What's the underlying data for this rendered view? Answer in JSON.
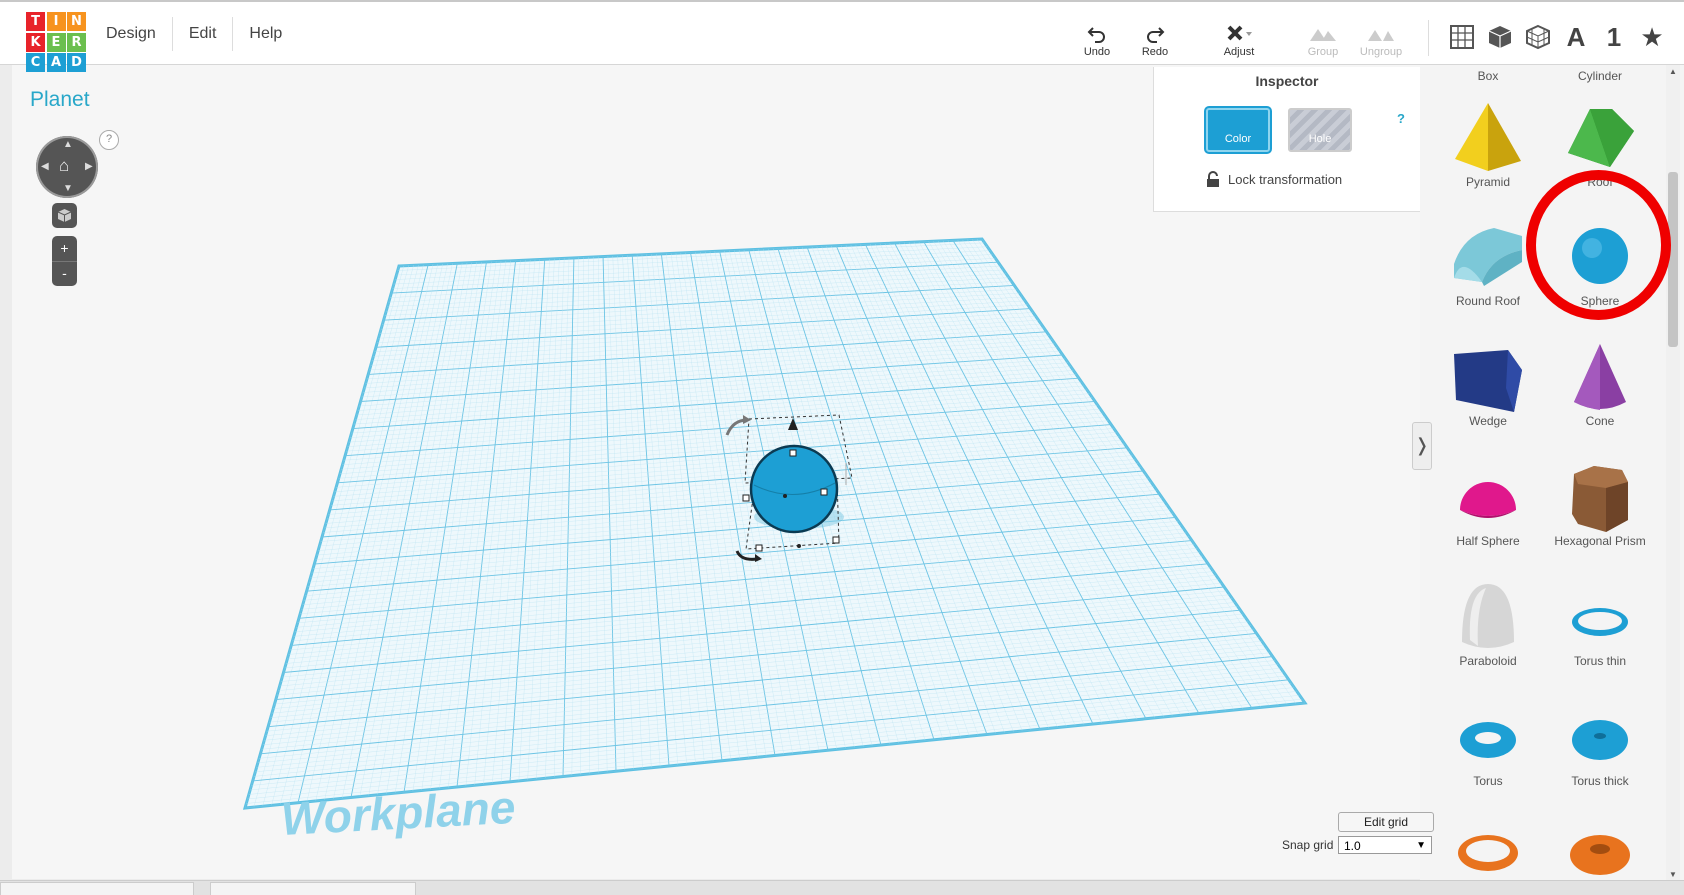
{
  "logo": {
    "letters": [
      "T",
      "I",
      "N",
      "K",
      "E",
      "R",
      "C",
      "A",
      "D"
    ],
    "colors": [
      "#e8232a",
      "#f7931e",
      "#f7931e",
      "#e8232a",
      "#6bbf4e",
      "#6bbf4e",
      "#1d9fd4",
      "#1d9fd4",
      "#1d9fd4"
    ]
  },
  "menu": {
    "design": "Design",
    "edit": "Edit",
    "help": "Help"
  },
  "toolbar": {
    "undo": "Undo",
    "redo": "Redo",
    "adjust": "Adjust",
    "group": "Group",
    "ungroup": "Ungroup"
  },
  "view_icons": {
    "grid": "grid-view-icon",
    "box": "box-view-icon",
    "wireframe": "wireframe-icon",
    "text": "A",
    "number": "1",
    "star": "★"
  },
  "design": {
    "name": "Planet"
  },
  "viewcube": {
    "help": "?",
    "zoom_in": "+",
    "zoom_out": "-"
  },
  "inspector": {
    "title": "Inspector",
    "color_label": "Color",
    "hole_label": "Hole",
    "lock_label": "Lock transformation",
    "help": "?",
    "color": "#1d9fd4"
  },
  "workplane": {
    "label": "Workplane"
  },
  "grid_controls": {
    "edit_grid": "Edit grid",
    "snap_label": "Snap grid",
    "snap_value": "1.0"
  },
  "shapes": [
    {
      "label": "Box"
    },
    {
      "label": "Cylinder"
    },
    {
      "label": "Pyramid"
    },
    {
      "label": "Roof"
    },
    {
      "label": "Round Roof"
    },
    {
      "label": "Sphere"
    },
    {
      "label": "Wedge"
    },
    {
      "label": "Cone"
    },
    {
      "label": "Half Sphere"
    },
    {
      "label": "Hexagonal Prism"
    },
    {
      "label": "Paraboloid"
    },
    {
      "label": "Torus thin"
    },
    {
      "label": "Torus"
    },
    {
      "label": "Torus thick"
    }
  ],
  "panel": {
    "collapse": "❭"
  }
}
